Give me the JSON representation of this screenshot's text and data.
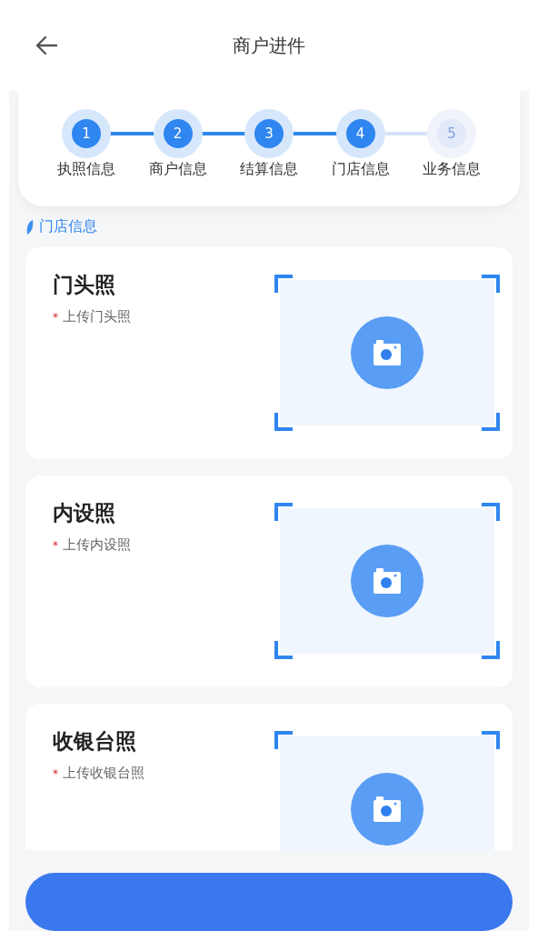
{
  "header": {
    "title": "商户进件"
  },
  "steps": [
    {
      "number": "1",
      "label": "执照信息",
      "active": true
    },
    {
      "number": "2",
      "label": "商户信息",
      "active": true
    },
    {
      "number": "3",
      "label": "结算信息",
      "active": true
    },
    {
      "number": "4",
      "label": "门店信息",
      "active": true
    },
    {
      "number": "5",
      "label": "业务信息",
      "active": false
    }
  ],
  "section": {
    "title": "门店信息"
  },
  "uploads": [
    {
      "title": "门头照",
      "mark": "*",
      "hint": "上传门头照"
    },
    {
      "title": "内设照",
      "mark": "*",
      "hint": "上传内设照"
    },
    {
      "title": "收银台照",
      "mark": "*",
      "hint": "上传收银台照"
    }
  ]
}
